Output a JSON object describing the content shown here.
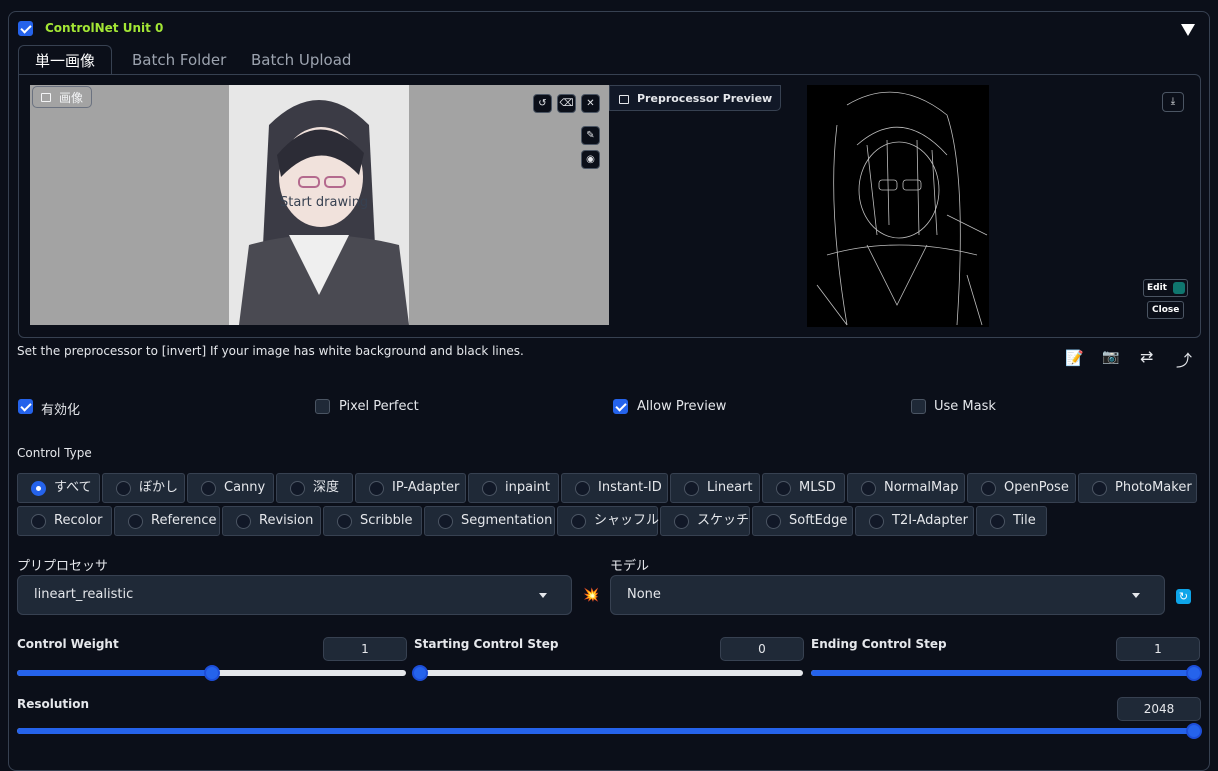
{
  "unit": {
    "title": "ControlNet Unit 0",
    "enabled": true,
    "collapse_icon": "triangle-down-icon"
  },
  "tabs": [
    {
      "label": "単一画像",
      "active": true
    },
    {
      "label": "Batch Folder"
    },
    {
      "label": "Batch Upload"
    }
  ],
  "image_panel": {
    "label": "画像",
    "canvas_text": "Start drawing",
    "icons": [
      "undo-icon",
      "eraser-icon",
      "close-icon",
      "brush-icon",
      "palette-icon"
    ]
  },
  "preview_panel": {
    "label": "Preprocessor Preview",
    "edit_label": "Edit",
    "close_label": "Close",
    "icons": [
      "download-icon",
      "edit-icon"
    ]
  },
  "hint": "Set the preprocessor to [invert] If your image has white background and black lines.",
  "tool_icons": [
    "notepad-icon",
    "camera-icon",
    "swap-icon",
    "curved-arrow-icon"
  ],
  "options": [
    {
      "label": "有効化",
      "checked": true
    },
    {
      "label": "Pixel Perfect",
      "checked": false
    },
    {
      "label": "Allow Preview",
      "checked": true
    },
    {
      "label": "Use Mask",
      "checked": false
    }
  ],
  "control_type": {
    "label": "Control Type",
    "selected": "すべて",
    "row1": [
      "すべて",
      "ぼかし",
      "Canny",
      "深度",
      "IP-Adapter",
      "inpaint",
      "Instant-ID",
      "Lineart",
      "MLSD",
      "NormalMap",
      "OpenPose",
      "PhotoMaker"
    ],
    "row2": [
      "Recolor",
      "Reference",
      "Revision",
      "Scribble",
      "Segmentation",
      "シャッフル",
      "スケッチ",
      "SoftEdge",
      "T2I-Adapter",
      "Tile"
    ]
  },
  "preprocessor": {
    "label": "プリプロセッサ",
    "value": "lineart_realistic",
    "run_icon": "explosion-icon"
  },
  "model": {
    "label": "モデル",
    "value": "None",
    "refresh_icon": "refresh-icon"
  },
  "sliders": {
    "control_weight": {
      "label": "Control Weight",
      "value": "1",
      "fraction": 0.5
    },
    "starting_step": {
      "label": "Starting Control Step",
      "value": "0",
      "fraction": 0.0
    },
    "ending_step": {
      "label": "Ending Control Step",
      "value": "1",
      "fraction": 1.0
    },
    "resolution": {
      "label": "Resolution",
      "value": "2048",
      "fraction": 1.0
    }
  },
  "colors": {
    "accent": "#2563eb",
    "title_green": "#a3e635",
    "bg": "#0b0f19"
  }
}
